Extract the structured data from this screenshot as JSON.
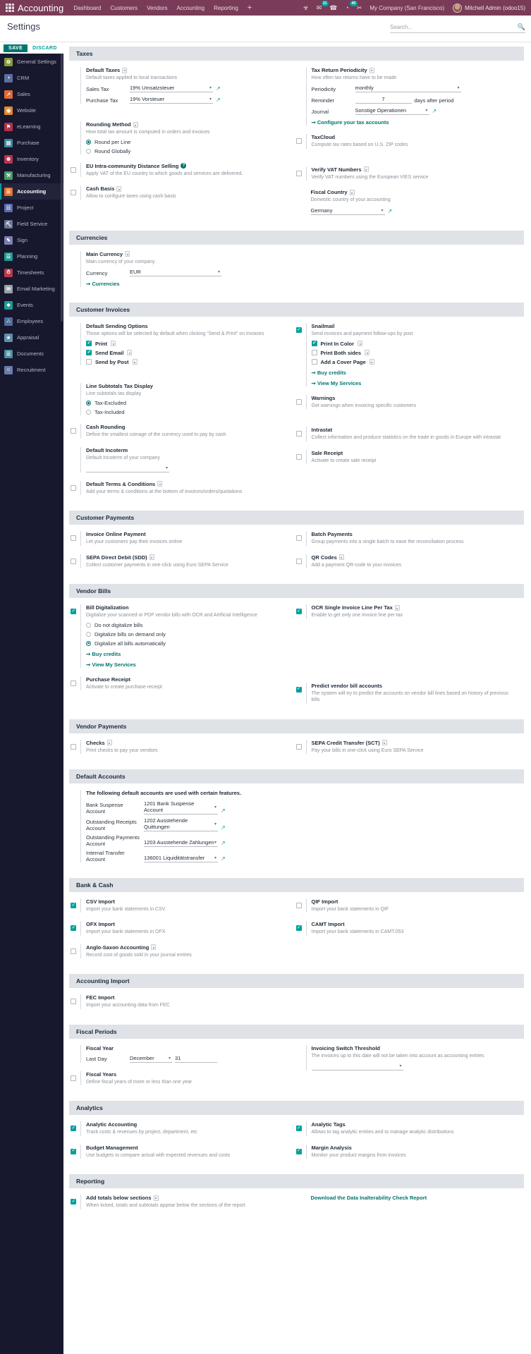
{
  "navbar": {
    "apps_icon": "apps-grid-icon",
    "brand": "Accounting",
    "menus": [
      "Dashboard",
      "Customers",
      "Vendors",
      "Accounting",
      "Reporting"
    ],
    "plus": "+",
    "icons": [
      {
        "name": "bug-icon",
        "glyph": "☣",
        "badge": ""
      },
      {
        "name": "messages-icon",
        "glyph": "✉",
        "badge": "11"
      },
      {
        "name": "phone-icon",
        "glyph": "☎",
        "badge": ""
      },
      {
        "name": "activities-clock-icon",
        "glyph": "◔",
        "badge": "45"
      },
      {
        "name": "shortcut-icon",
        "glyph": "✂",
        "badge": ""
      }
    ],
    "company": "My Company (San Francisco)",
    "user": "Mitchell Admin (odoo15)"
  },
  "control_panel": {
    "title": "Settings",
    "search_placeholder": "Search...",
    "search_value": "",
    "search_icon": "search-icon"
  },
  "actions": {
    "save": "SAVE",
    "discard": "DISCARD"
  },
  "sidebar": {
    "items": [
      {
        "label": "General Settings",
        "color": "#8a9a3b",
        "glyph": "⚙",
        "active": false
      },
      {
        "label": "CRM",
        "color": "#5b6f9e",
        "glyph": "◑",
        "active": false
      },
      {
        "label": "Sales",
        "color": "#e06a3a",
        "glyph": "↗",
        "active": false
      },
      {
        "label": "Website",
        "color": "#e08a2a",
        "glyph": "◉",
        "active": false
      },
      {
        "label": "eLearning",
        "color": "#b0324a",
        "glyph": "⚑",
        "active": false
      },
      {
        "label": "Purchase",
        "color": "#3f8a9c",
        "glyph": "▤",
        "active": false
      },
      {
        "label": "Inventory",
        "color": "#b8344f",
        "glyph": "☸",
        "active": false
      },
      {
        "label": "Manufacturing",
        "color": "#4a9a6a",
        "glyph": "⚒",
        "active": false
      },
      {
        "label": "Accounting",
        "color": "#e0712c",
        "glyph": "☰",
        "active": true
      },
      {
        "label": "Project",
        "color": "#5c6ba8",
        "glyph": "☷",
        "active": false
      },
      {
        "label": "Field Service",
        "color": "#6b7596",
        "glyph": "⛏",
        "active": false
      },
      {
        "label": "Sign",
        "color": "#7d7fb0",
        "glyph": "✎",
        "active": false
      },
      {
        "label": "Planning",
        "color": "#1f9a93",
        "glyph": "☲",
        "active": false
      },
      {
        "label": "Timesheets",
        "color": "#b83a4a",
        "glyph": "⏱",
        "active": false
      },
      {
        "label": "Email Marketing",
        "color": "#9aa0a8",
        "glyph": "✉",
        "active": false
      },
      {
        "label": "Events",
        "color": "#1f9a93",
        "glyph": "❖",
        "active": false
      },
      {
        "label": "Employees",
        "color": "#4f6f9a",
        "glyph": "⛬",
        "active": false
      },
      {
        "label": "Appraisal",
        "color": "#5f8fa8",
        "glyph": "★",
        "active": false
      },
      {
        "label": "Documents",
        "color": "#4a8fa0",
        "glyph": "☰",
        "active": false
      },
      {
        "label": "Recruitment",
        "color": "#6a7ca8",
        "glyph": "☺",
        "active": false
      }
    ]
  },
  "sections": {
    "taxes": {
      "heading": "Taxes",
      "default_taxes": {
        "title": "Default Taxes",
        "desc": "Default taxes applied to local transactions",
        "sales_label": "Sales Tax",
        "sales_value": "19% Umsatzsteuer",
        "purchase_label": "Purchase Tax",
        "purchase_value": "19% Vorsteuer"
      },
      "tax_return_periodicity": {
        "title": "Tax Return Periodicity",
        "desc": "How often tax returns have to be made",
        "periodicity_label": "Periodicity",
        "periodicity_value": "monthly",
        "reminder_label": "Reminder",
        "reminder_value": "7",
        "reminder_suffix": "days after period",
        "journal_label": "Journal",
        "journal_value": "Sonstige Operationen",
        "configure_link": "Configure your tax accounts"
      },
      "rounding_method": {
        "title": "Rounding Method",
        "desc": "How total tax amount is computed in orders and invoices",
        "options": [
          "Round per Line",
          "Round Globally"
        ],
        "selected": "Round per Line"
      },
      "taxcloud": {
        "title": "TaxCloud",
        "desc": "Compute tax rates based on U.S. ZIP codes",
        "checked": false
      },
      "eu_distance_selling": {
        "title": "EU Intra-community Distance Selling",
        "desc": "Apply VAT of the EU country to which goods and services are delivered.",
        "checked": false
      },
      "verify_vat": {
        "title": "Verify VAT Numbers",
        "desc": "Verify VAT numbers using the European VIES service",
        "checked": false
      },
      "cash_basis": {
        "title": "Cash Basis",
        "desc": "Allow to configure taxes using cash basis",
        "checked": false
      },
      "fiscal_country": {
        "title": "Fiscal Country",
        "desc": "Domestic country of your accounting",
        "value": "Germany"
      }
    },
    "currencies": {
      "heading": "Currencies",
      "main_currency": {
        "title": "Main Currency",
        "desc": "Main currency of your company",
        "currency_label": "Currency",
        "currency_value": "EUR",
        "link": "Currencies"
      }
    },
    "customer_invoices": {
      "heading": "Customer Invoices",
      "default_sending": {
        "title": "Default Sending Options",
        "desc": "Those options will be selected by default when clicking \"Send & Print\" on invoices",
        "options": [
          {
            "label": "Print",
            "checked": true
          },
          {
            "label": "Send Email",
            "checked": true
          },
          {
            "label": "Send by Post",
            "checked": false
          }
        ]
      },
      "snailmail": {
        "title": "Snailmail",
        "desc": "Send invoices and payment follow-ups by post",
        "checked": true,
        "options": [
          {
            "label": "Print In Color",
            "checked": true
          },
          {
            "label": "Print Both sides",
            "checked": false
          },
          {
            "label": "Add a Cover Page",
            "checked": false
          }
        ],
        "links": [
          "Buy credits",
          "View My Services"
        ]
      },
      "line_subtotals": {
        "title": "Line Subtotals Tax Display",
        "desc": "Line subtotals tax display",
        "options": [
          "Tax-Excluded",
          "Tax-Included"
        ],
        "selected": "Tax-Excluded"
      },
      "warnings": {
        "title": "Warnings",
        "desc": "Get warnings when invoicing specific customers",
        "checked": false
      },
      "cash_rounding": {
        "title": "Cash Rounding",
        "desc": "Define the smallest coinage of the currency used to pay by cash",
        "checked": false
      },
      "intrastat": {
        "title": "Intrastat",
        "desc": "Collect information and produce statistics on the trade in goods in Europe with intrastat",
        "checked": false
      },
      "default_incoterm": {
        "title": "Default Incoterm",
        "desc": "Default Incoterm of your company",
        "value": ""
      },
      "sale_receipt": {
        "title": "Sale Receipt",
        "desc": "Activate to create sale receipt",
        "checked": false
      },
      "default_terms": {
        "title": "Default Terms & Conditions",
        "desc": "Add your terms & conditions at the bottom of invoices/orders/quotations",
        "checked": false
      }
    },
    "customer_payments": {
      "heading": "Customer Payments",
      "items": [
        {
          "title": "Invoice Online Payment",
          "desc": "Let your customers pay their invoices online",
          "checked": false,
          "info": false
        },
        {
          "title": "Batch Payments",
          "desc": "Group payments into a single batch to ease the reconciliation process",
          "checked": false,
          "info": false
        },
        {
          "title": "SEPA Direct Debit (SDD)",
          "desc": "Collect customer payments in one-click using Euro SEPA Service",
          "checked": false,
          "info": true
        },
        {
          "title": "QR Codes",
          "desc": "Add a payment QR-code to your invoices",
          "checked": false,
          "info": true
        }
      ]
    },
    "vendor_bills": {
      "heading": "Vendor Bills",
      "bill_digitalization": {
        "title": "Bill Digitalization",
        "desc": "Digitalize your scanned or PDF vendor bills with OCR and Artificial Intelligence",
        "checked": true,
        "options": [
          "Do not digitalize bills",
          "Digitalize bills on demand only",
          "Digitalize all bills automatically"
        ],
        "selected": "Digitalize all bills automatically",
        "links": [
          "Buy credits",
          "View My Services"
        ]
      },
      "ocr_single_line": {
        "title": "OCR Single Invoice Line Per Tax",
        "desc": "Enable to get only one invoice line per tax",
        "checked": true
      },
      "purchase_receipt": {
        "title": "Purchase Receipt",
        "desc": "Activate to create purchase receipt",
        "checked": false
      },
      "predict_accounts": {
        "title": "Predict vendor bill accounts",
        "desc": "The system will try to predict the accounts on vendor bill lines based on history of previous bills",
        "checked": true
      }
    },
    "vendor_payments": {
      "heading": "Vendor Payments",
      "items": [
        {
          "title": "Checks",
          "desc": "Print checks to pay your vendors",
          "checked": false,
          "info": true
        },
        {
          "title": "SEPA Credit Transfer (SCT)",
          "desc": "Pay your bills in one-click using Euro SEPA Service",
          "checked": false,
          "info": true
        }
      ]
    },
    "default_accounts": {
      "heading": "Default Accounts",
      "note": "The following default accounts are used with certain features.",
      "rows": [
        {
          "label": "Bank Suspense Account",
          "value": "1201 Bank Suspense Account"
        },
        {
          "label": "Outstanding Receipts Account",
          "value": "1202 Ausstehende Quittungen"
        },
        {
          "label": "Outstanding Payments Account",
          "value": "1203 Ausstehende Zahlungen"
        },
        {
          "label": "Internal Transfer Account",
          "value": "136001 Liquiditätstransfer"
        }
      ]
    },
    "bank_cash": {
      "heading": "Bank & Cash",
      "items": [
        {
          "title": "CSV Import",
          "desc": "Import your bank statements in CSV",
          "checked": true,
          "info": false
        },
        {
          "title": "QIF Import",
          "desc": "Import your bank statements in QIF",
          "checked": false,
          "info": false
        },
        {
          "title": "OFX Import",
          "desc": "Import your bank statements in OFX",
          "checked": true,
          "info": false
        },
        {
          "title": "CAMT Import",
          "desc": "Import your bank statements in CAMT.053",
          "checked": true,
          "info": false
        },
        {
          "title": "Anglo-Saxon Accounting",
          "desc": "Record cost of goods sold in your journal entries",
          "checked": false,
          "info": true
        }
      ]
    },
    "accounting_import": {
      "heading": "Accounting Import",
      "items": [
        {
          "title": "FEC Import",
          "desc": "Import your accounting data from FEC",
          "checked": false,
          "info": false
        }
      ]
    },
    "fiscal_periods": {
      "heading": "Fiscal Periods",
      "fiscal_year": {
        "title": "Fiscal Year",
        "last_day_label": "Last Day",
        "month_value": "December",
        "day_value": "31"
      },
      "invoicing_switch": {
        "title": "Invoicing Switch Threshold",
        "desc": "The invoices up to this date will not be taken into account as accounting entries",
        "value": ""
      },
      "fiscal_years": {
        "title": "Fiscal Years",
        "desc": "Define fiscal years of more or less than one year",
        "checked": false
      }
    },
    "analytics": {
      "heading": "Analytics",
      "items": [
        {
          "title": "Analytic Accounting",
          "desc": "Track costs & revenues by project, department, etc",
          "checked": true
        },
        {
          "title": "Analytic Tags",
          "desc": "Allows to tag analytic entries and to manage analytic distributions",
          "checked": true
        },
        {
          "title": "Budget Management",
          "desc": "Use budgets to compare actual with expected revenues and costs",
          "checked": true
        },
        {
          "title": "Margin Analysis",
          "desc": "Monitor your product margins from invoices",
          "checked": true
        }
      ]
    },
    "reporting": {
      "heading": "Reporting",
      "add_totals": {
        "title": "Add totals below sections",
        "desc": "When ticked, totals and subtotals appear below the sections of the report",
        "checked": true
      },
      "download_link": "Download the Data Inalterability Check Report"
    }
  },
  "colors": {
    "brand_purple": "#793b58",
    "accent_teal": "#00a09d",
    "accent_teal_dark": "#00756e",
    "sidebar_bg": "#17172e",
    "section_header_bg": "#dfe2e7"
  }
}
